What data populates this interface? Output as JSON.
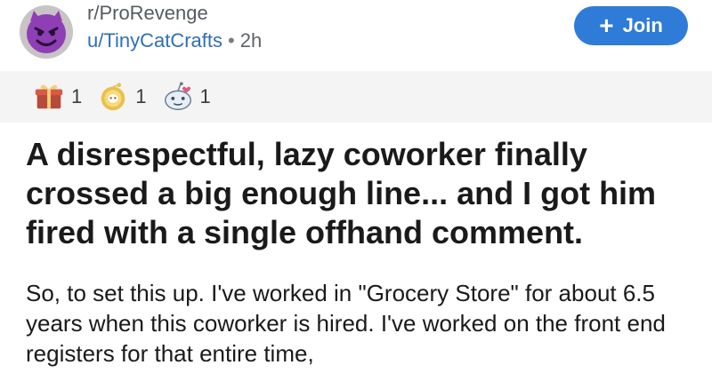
{
  "post": {
    "subreddit": "r/ProRevenge",
    "author": "u/TinyCatCrafts",
    "separator": "•",
    "age": "2h",
    "join_label": "Join",
    "join_icon": "plus-icon",
    "avatar_icon": "devil-face-icon",
    "awards": [
      {
        "icon": "gift-award-icon",
        "count": "1"
      },
      {
        "icon": "gold-award-icon",
        "count": "1"
      },
      {
        "icon": "wholesome-award-icon",
        "count": "1"
      }
    ],
    "title": "A disrespectful, lazy coworker finally crossed a big enough line... and I got him fired with a single offhand comment.",
    "body": "So, to set this up. I've worked in \"Grocery Store\" for about 6.5 years when this coworker is hired. I've worked on the front end registers for that entire time,"
  },
  "colors": {
    "join_button": "#2f7bd8",
    "username": "#2f6fb6",
    "awards_bar": "#f4f4f4"
  }
}
